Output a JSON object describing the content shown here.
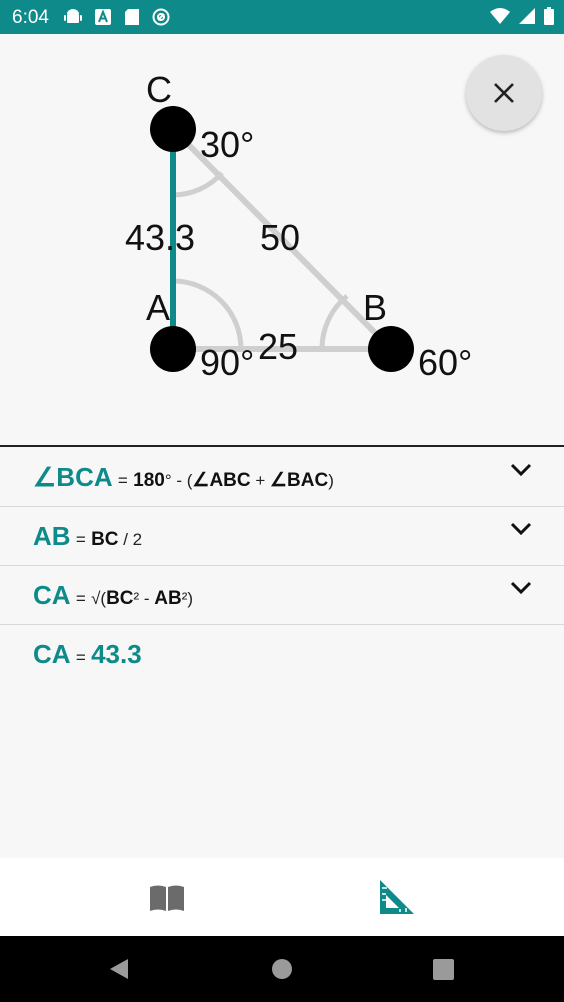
{
  "status": {
    "time": "6:04",
    "icons_left": [
      "android-icon",
      "a-box-icon",
      "sd-card-icon",
      "at-sign-icon"
    ],
    "icons_right": [
      "wifi-icon",
      "cell-signal-icon",
      "battery-icon"
    ]
  },
  "colors": {
    "accent": "#0e8a8a",
    "status_bar": "#0e8a8a",
    "highlight_line": "#0e8a8a",
    "inactive_line": "#cfcfcf"
  },
  "diagram": {
    "vertices": {
      "a": "A",
      "b": "B",
      "c": "C"
    },
    "angles": {
      "a": "90°",
      "b": "60°",
      "c": "30°"
    },
    "sides": {
      "ca": "43.3",
      "cb": "50",
      "ab": "25"
    }
  },
  "formulas": [
    {
      "lhs": "∠BCA",
      "eq": "=",
      "p1": "180",
      "p2": "° - (",
      "p3": "∠ABC",
      "p4": " + ",
      "p5": "∠BAC",
      "p6": ")"
    },
    {
      "lhs": "AB",
      "eq": "=",
      "p1": "BC",
      "p2": " / 2"
    },
    {
      "lhs": "CA",
      "eq": "=",
      "p1": "√(",
      "p2": "BC",
      "p3": "²",
      "p4": " - ",
      "p5": "AB",
      "p6": "²)"
    },
    {
      "lhs": "CA",
      "eq": "=",
      "result": "43.3"
    }
  ],
  "bottom_nav": {
    "left_icon": "book-icon",
    "right_icon": "set-square-icon"
  }
}
